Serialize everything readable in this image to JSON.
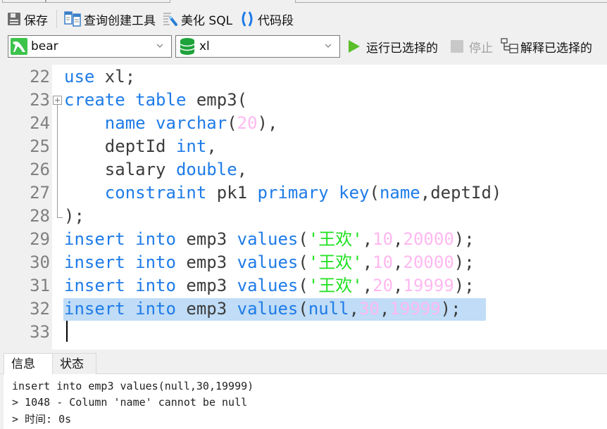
{
  "toolbar": {
    "save_label": "保存",
    "query_builder_label": "查询创建工具",
    "beautify_sql_label": "美化 SQL",
    "code_snippet_label": "代码段"
  },
  "connection": {
    "selected": "bear"
  },
  "database": {
    "selected": "xl"
  },
  "run_bar": {
    "run_selected_label": "运行已选择的",
    "stop_label": "停止",
    "explain_selected_label": "解释已选择的"
  },
  "editor": {
    "lines": [
      {
        "number": "22",
        "tokens": [
          {
            "t": "use",
            "c": "kw"
          },
          {
            "t": " xl;",
            "c": ""
          }
        ]
      },
      {
        "number": "23",
        "tokens": [
          {
            "t": "create table",
            "c": "kw"
          },
          {
            "t": " emp3(",
            "c": ""
          }
        ]
      },
      {
        "number": "24",
        "tokens": [
          {
            "t": "    ",
            "c": ""
          },
          {
            "t": "name varchar",
            "c": "kw"
          },
          {
            "t": "(",
            "c": ""
          },
          {
            "t": "20",
            "c": "num"
          },
          {
            "t": "),",
            "c": ""
          }
        ]
      },
      {
        "number": "25",
        "tokens": [
          {
            "t": "    deptId ",
            "c": ""
          },
          {
            "t": "int",
            "c": "kw"
          },
          {
            "t": ",",
            "c": ""
          }
        ]
      },
      {
        "number": "26",
        "tokens": [
          {
            "t": "    salary ",
            "c": ""
          },
          {
            "t": "double",
            "c": "kw"
          },
          {
            "t": ",",
            "c": ""
          }
        ]
      },
      {
        "number": "27",
        "tokens": [
          {
            "t": "    ",
            "c": ""
          },
          {
            "t": "constraint",
            "c": "kw"
          },
          {
            "t": " pk1 ",
            "c": ""
          },
          {
            "t": "primary key",
            "c": "kw"
          },
          {
            "t": "(",
            "c": ""
          },
          {
            "t": "name",
            "c": "kw"
          },
          {
            "t": ",deptId)",
            "c": ""
          }
        ]
      },
      {
        "number": "28",
        "tokens": [
          {
            "t": ");",
            "c": ""
          }
        ]
      },
      {
        "number": "29",
        "tokens": [
          {
            "t": "insert into",
            "c": "kw"
          },
          {
            "t": " emp3 ",
            "c": ""
          },
          {
            "t": "values",
            "c": "kw"
          },
          {
            "t": "(",
            "c": ""
          },
          {
            "t": "'王欢'",
            "c": "str"
          },
          {
            "t": ",",
            "c": ""
          },
          {
            "t": "10",
            "c": "num"
          },
          {
            "t": ",",
            "c": ""
          },
          {
            "t": "20000",
            "c": "num"
          },
          {
            "t": ");",
            "c": ""
          }
        ]
      },
      {
        "number": "30",
        "tokens": [
          {
            "t": "insert into",
            "c": "kw"
          },
          {
            "t": " emp3 ",
            "c": ""
          },
          {
            "t": "values",
            "c": "kw"
          },
          {
            "t": "(",
            "c": ""
          },
          {
            "t": "'王欢'",
            "c": "str"
          },
          {
            "t": ",",
            "c": ""
          },
          {
            "t": "10",
            "c": "num"
          },
          {
            "t": ",",
            "c": ""
          },
          {
            "t": "20000",
            "c": "num"
          },
          {
            "t": ");",
            "c": ""
          }
        ]
      },
      {
        "number": "31",
        "tokens": [
          {
            "t": "insert into",
            "c": "kw"
          },
          {
            "t": " emp3 ",
            "c": ""
          },
          {
            "t": "values",
            "c": "kw"
          },
          {
            "t": "(",
            "c": ""
          },
          {
            "t": "'王欢'",
            "c": "str"
          },
          {
            "t": ",",
            "c": ""
          },
          {
            "t": "20",
            "c": "num"
          },
          {
            "t": ",",
            "c": ""
          },
          {
            "t": "19999",
            "c": "num"
          },
          {
            "t": ");",
            "c": ""
          }
        ]
      },
      {
        "number": "32",
        "tokens": [
          {
            "t": "insert into",
            "c": "kw"
          },
          {
            "t": " emp3 ",
            "c": ""
          },
          {
            "t": "values",
            "c": "kw"
          },
          {
            "t": "(",
            "c": ""
          },
          {
            "t": "null",
            "c": "kw"
          },
          {
            "t": ",",
            "c": ""
          },
          {
            "t": "30",
            "c": "num"
          },
          {
            "t": ",",
            "c": ""
          },
          {
            "t": "19999",
            "c": "num"
          },
          {
            "t": ");",
            "c": ""
          }
        ]
      },
      {
        "number": "33",
        "tokens": []
      }
    ],
    "selected_line": "32"
  },
  "result_tabs": [
    {
      "label": "信息",
      "active": true
    },
    {
      "label": "状态",
      "active": false
    }
  ],
  "messages": [
    "insert into emp3 values(null,30,19999)",
    "> 1048 - Column 'name' cannot be null",
    "> 时间: 0s"
  ],
  "colors": {
    "keyword": "#1e7be8",
    "number": "#ffb8f0",
    "string": "#20e020",
    "selection": "#c0dcf6",
    "run_green": "#5bbf2a"
  }
}
